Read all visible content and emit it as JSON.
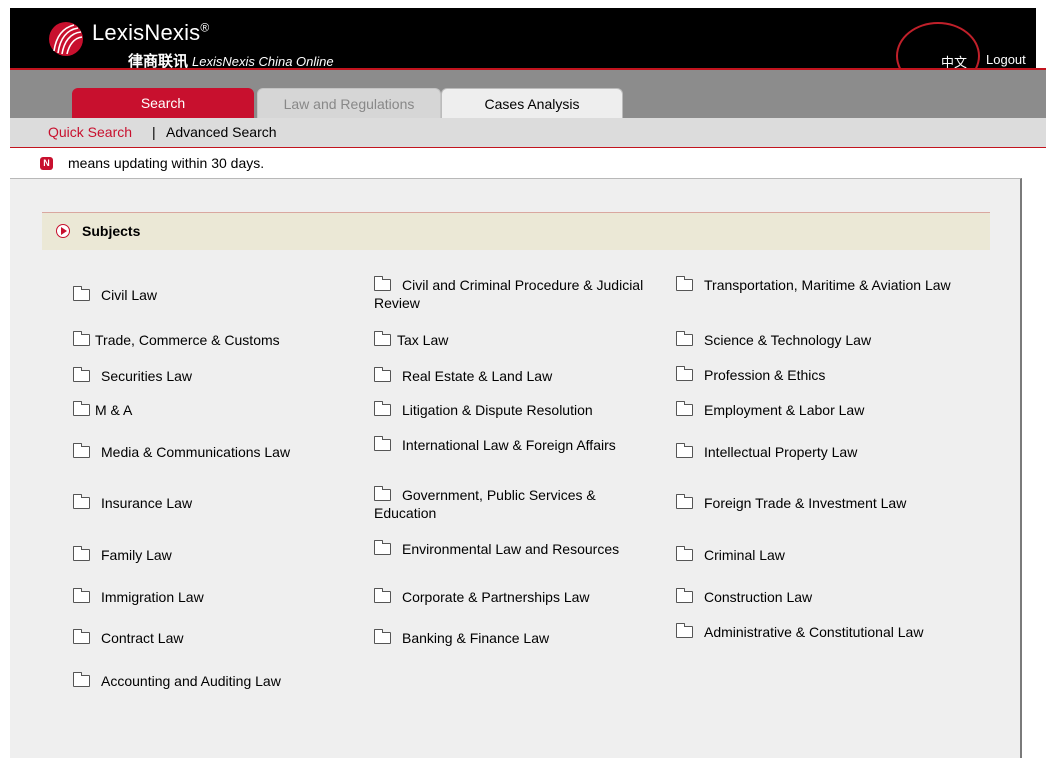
{
  "header": {
    "brand": "LexisNexis",
    "brand_mark": "®",
    "sub_cn": "律商联讯",
    "sub_en": "LexisNexis China Online",
    "lang_link": "中文",
    "logout": "Logout"
  },
  "tabs": [
    {
      "label": "Search",
      "active": true
    },
    {
      "label": "Law and Regulations",
      "active": false
    },
    {
      "label": "Cases Analysis",
      "active": false
    }
  ],
  "subnav": {
    "quick": "Quick Search",
    "separator": "|",
    "advanced": "Advanced Search"
  },
  "legend": {
    "badge": "N",
    "text": "means updating within 30 days."
  },
  "subjects": {
    "title": "Subjects",
    "columns": [
      [
        "Civil Law",
        "Trade, Commerce & Customs",
        "Securities Law",
        "M & A",
        "Media & Communications Law",
        "Insurance Law",
        "Family Law",
        "Immigration Law",
        "Contract Law",
        "Accounting and Auditing Law"
      ],
      [
        "Civil and Criminal Procedure & Judicial Review",
        "Tax Law",
        "Real Estate & Land Law",
        "Litigation & Dispute Resolution",
        "International Law & Foreign Affairs",
        "Government, Public Services & Education",
        "Environmental Law and Resources",
        "Corporate & Partnerships Law",
        "Banking & Finance Law"
      ],
      [
        "Transportation, Maritime & Aviation Law",
        "Science & Technology Law",
        "Profession & Ethics",
        "Employment & Labor Law",
        "Intellectual Property Law",
        "Foreign Trade & Investment Law",
        "Criminal Law",
        "Construction Law",
        "Administrative & Constitutional Law"
      ]
    ]
  },
  "colors": {
    "brand_red": "#c8102e",
    "header_bg": "#000000",
    "tabbar_bg": "#8c8c8c",
    "subjects_header_bg": "#ebe8d6"
  }
}
